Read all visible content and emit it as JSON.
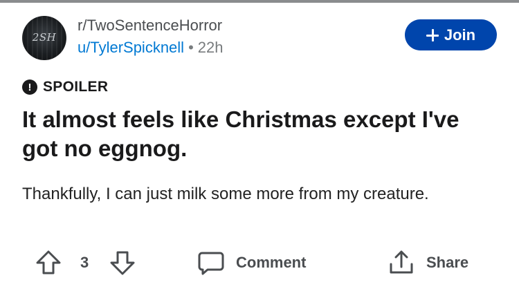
{
  "post": {
    "subreddit": "r/TwoSentenceHorror",
    "author": "u/TylerSpicknell",
    "separator": "•",
    "age": "22h",
    "avatar_text": "2SH",
    "join_label": "Join",
    "spoiler_icon_text": "!",
    "spoiler_label": "SPOILER",
    "title": "It almost feels like Christmas except I've got no eggnog.",
    "body": "Thankfully, I can just milk some more from my creature.",
    "votes": "3",
    "comment_label": "Comment",
    "share_label": "Share"
  },
  "icons": [
    "plus-icon",
    "spoiler-icon",
    "upvote-icon",
    "downvote-icon",
    "comment-icon",
    "share-icon"
  ],
  "colors": {
    "join_button": "#0045ac",
    "username": "#0079d3",
    "muted_text": "#787c7e",
    "action_gray": "#4a4d50"
  }
}
